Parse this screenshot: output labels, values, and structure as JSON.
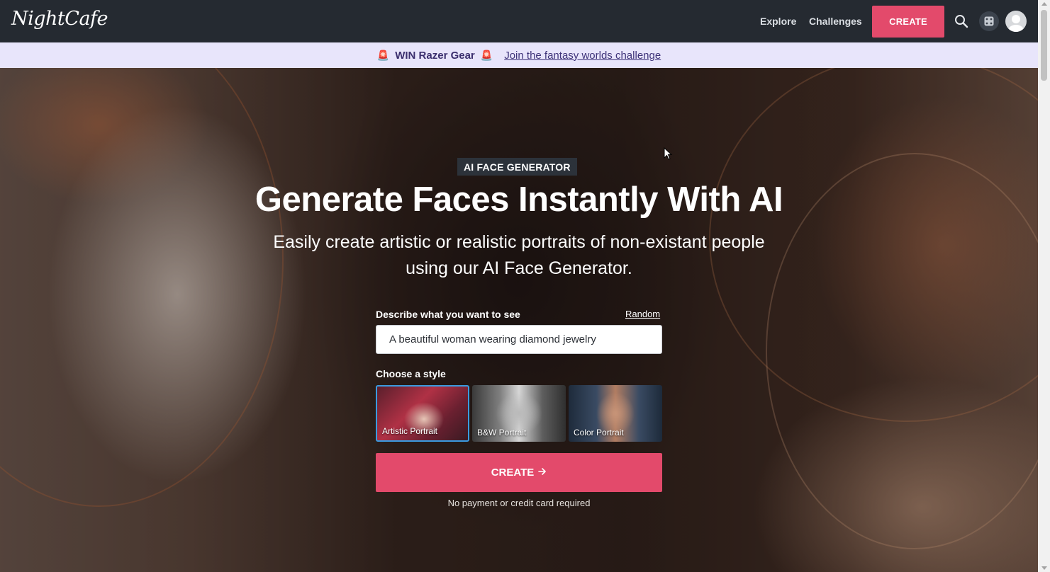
{
  "nav": {
    "logo_text": "NightCafe",
    "explore_label": "Explore",
    "challenges_label": "Challenges",
    "create_label": "CREATE",
    "icons": [
      "search-icon",
      "dice-icon",
      "avatar-icon"
    ]
  },
  "banner": {
    "win_text": "WIN Razer Gear",
    "link_text": "Join the fantasy worlds challenge",
    "icon": "siren-icon"
  },
  "hero": {
    "badge": "AI FACE GENERATOR",
    "headline": "Generate Faces Instantly With AI",
    "subheadline": "Easily create artistic or realistic portraits of non-existant people using our AI Face Generator."
  },
  "form": {
    "prompt_label": "Describe what you want to see",
    "random_label": "Random",
    "prompt_value": "A beautiful woman wearing diamond jewelry",
    "style_label": "Choose a style",
    "styles": [
      {
        "label": "Artistic Portrait",
        "selected": true
      },
      {
        "label": "B&W Portrait",
        "selected": false
      },
      {
        "label": "Color Portrait",
        "selected": false
      }
    ],
    "create_label": "CREATE",
    "create_icon": "arrow-right-icon",
    "note": "No payment or credit card required"
  },
  "colors": {
    "nav_bg": "#252a31",
    "accent": "#e34a6b",
    "banner_bg": "#e8e5fb",
    "selected_border": "#3a9be0"
  }
}
